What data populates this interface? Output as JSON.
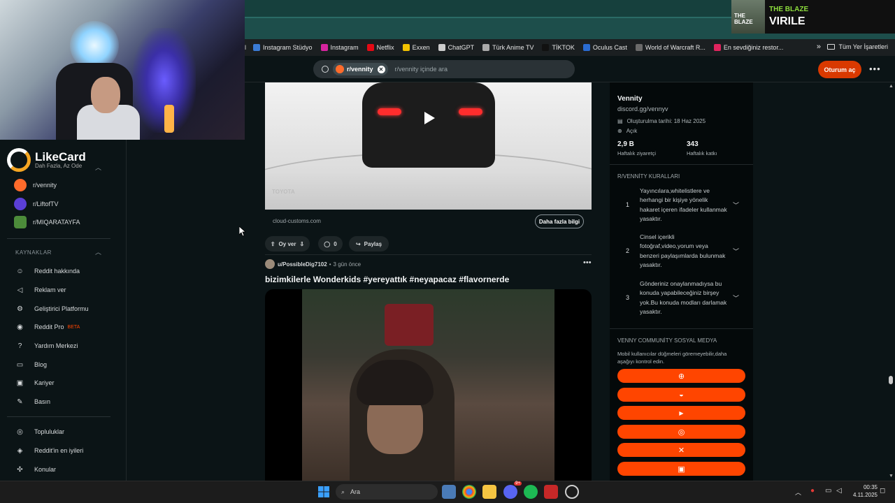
{
  "bookmarks": [
    {
      "label": "Instagram Stüdyo",
      "color": "#3a7bd5"
    },
    {
      "label": "Instagram",
      "color": "#d6249f"
    },
    {
      "label": "Netflix",
      "color": "#e50914"
    },
    {
      "label": "Exxen",
      "color": "#f2c200"
    },
    {
      "label": "ChatGPT",
      "color": "#cccccc"
    },
    {
      "label": "Türk Anime TV",
      "color": "#aaaaaa"
    },
    {
      "label": "TİKTOK",
      "color": "#111111"
    },
    {
      "label": "Oculus Cast",
      "color": "#2a6bd1"
    },
    {
      "label": "World of Warcraft R...",
      "color": "#6a6a6a"
    },
    {
      "label": "En sevdiğiniz restor...",
      "color": "#e0245e"
    }
  ],
  "bookmarks_more": "»",
  "bookmarks_all": "Tüm Yer İşaretleri",
  "overlay": {
    "title": "THE BLAZE",
    "subtitle": "VIRILE",
    "thumb_text": "THE BLAZE"
  },
  "header": {
    "search_chip": "r/vennity",
    "search_placeholder": "r/vennity içinde ara",
    "login": "Oturum aç",
    "more": "•••"
  },
  "sidebar": {
    "brand": "LikeCard",
    "brand_sub": "Dah Fazla, Az Ode",
    "communities": [
      {
        "label": "r/vennity",
        "color": "#ff6b2b"
      },
      {
        "label": "r/LiftofTV",
        "color": "#5b3fd6"
      },
      {
        "label": "r/MIQARATAYFA",
        "color": "#4c8b3a"
      }
    ],
    "section_resources": "KAYNAKLAR",
    "resources": [
      {
        "label": "Reddit hakkında",
        "icon": "reddit-icon",
        "glyph": "☺"
      },
      {
        "label": "Reklam ver",
        "icon": "megaphone-icon",
        "glyph": "◁"
      },
      {
        "label": "Geliştirici Platformu",
        "icon": "gear-icon",
        "glyph": "⚙"
      },
      {
        "label": "Reddit Pro",
        "icon": "reddit-pro-icon",
        "glyph": "◉",
        "badge": "BETA"
      },
      {
        "label": "Yardım Merkezi",
        "icon": "help-icon",
        "glyph": "?"
      },
      {
        "label": "Blog",
        "icon": "book-icon",
        "glyph": "▭"
      },
      {
        "label": "Kariyer",
        "icon": "briefcase-icon",
        "glyph": "▣"
      },
      {
        "label": "Basın",
        "icon": "mic-icon",
        "glyph": "✎"
      }
    ],
    "more_links": [
      {
        "label": "Topluluklar",
        "icon": "communities-icon",
        "glyph": "◎"
      },
      {
        "label": "Reddit'in en iyileri",
        "icon": "best-icon",
        "glyph": "◈"
      },
      {
        "label": "Konular",
        "icon": "topics-icon",
        "glyph": "✣"
      }
    ]
  },
  "post1": {
    "domain": "cloud-customs.com",
    "cta": "Daha fazla bilgi",
    "vote_label": "Oy ver",
    "comments": "0",
    "share": "Paylaş",
    "watermark": "TOYOTA"
  },
  "post2": {
    "author": "u/PossibleDig7102",
    "time": "3 gün önce",
    "title": "bizimkilerle Wonderkids #yereyattık #neyapacaz #flavornerde",
    "more": "•••"
  },
  "right_panel": {
    "name": "Vennity",
    "link": "discord.gg/vennyv",
    "created": "Oluşturulma tarihi: 18 Haz 2025",
    "status": "Açık",
    "visitors_value": "2,9 B",
    "visitors_label": "Haftalık ziyaretçi",
    "contrib_value": "343",
    "contrib_label": "Haftalık katkı",
    "rules_title": "R/VENNİTY KURALLARI",
    "rules": [
      {
        "num": "1",
        "text": "Yayıncılara,whitelistlere ve herhangi bir kişiye yönelik hakaret içeren ifadeler kullanmak yasaktır."
      },
      {
        "num": "2",
        "text": "Cinsel içerikli fotoğraf,video,yorum veya benzeri paylaşımlarda bulunmak yasaktır."
      },
      {
        "num": "3",
        "text": "Gönderiniz onaylanmadıysa bu konuda yapabileceğiniz birşey yok.Bu konuda modları darlamak yasaktır."
      }
    ],
    "social_title": "VENNY COMMUNİTY SOSYAL MEDYA",
    "social_desc": "Mobil kullanıcılar düğmeleri göremeyebilir,daha aşağıyı kontrol edin.",
    "social_buttons": [
      {
        "icon": "globe-icon",
        "glyph": "⊕"
      },
      {
        "icon": "discord-icon",
        "glyph": "◒"
      },
      {
        "icon": "youtube-icon",
        "glyph": "▶"
      },
      {
        "icon": "instagram-icon",
        "glyph": "◎"
      },
      {
        "icon": "x-icon",
        "glyph": "✕"
      },
      {
        "icon": "twitch-icon",
        "glyph": "▣"
      }
    ]
  },
  "taskbar": {
    "search": "Ara",
    "time": "00:35",
    "date": "4.11.2025",
    "discord_badge": "9+"
  }
}
